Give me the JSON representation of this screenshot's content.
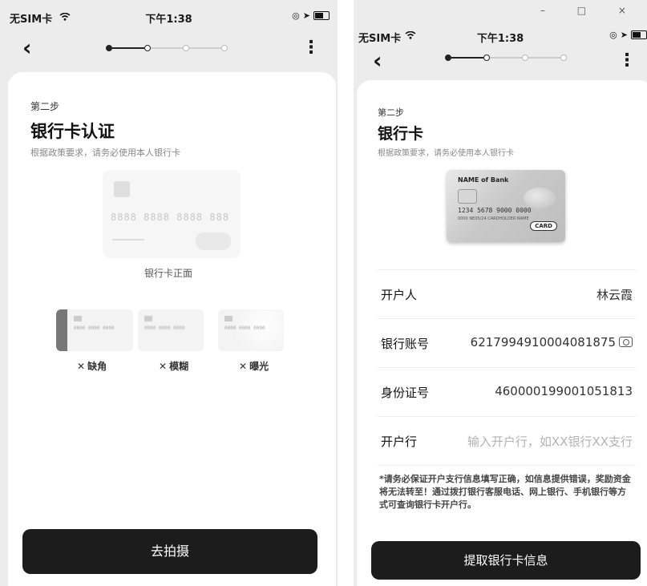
{
  "left": {
    "status": {
      "carrier": "无SIM卡",
      "time": "下午1:38"
    },
    "step_label": "第二步",
    "title": "银行卡认证",
    "subtitle": "根据政策要求，请务必使用本人银行卡",
    "card_number_sample": "8888 8888 8888 888",
    "card_caption": "银行卡正面",
    "examples": [
      {
        "label": "缺角",
        "mini": "0000 0000 0000"
      },
      {
        "label": "模糊",
        "mini": "0000 0000 0000"
      },
      {
        "label": "曝光",
        "mini": "0000 0000 0000"
      }
    ],
    "button_label": "去拍摄"
  },
  "right": {
    "window_controls": "– □ ×",
    "status": {
      "carrier": "无SIM卡",
      "time": "下午1:38"
    },
    "step_label": "第二步",
    "title": "银行卡",
    "subtitle": "根据政策要求，请务必使用本人银行卡",
    "card": {
      "bank_name": "NAME of Bank",
      "number": "1234 5678 9000 0000",
      "sub_text": "0000 NE05/24 CARDHOLDER NAME",
      "logo": "CARD"
    },
    "fields": [
      {
        "label": "开户人",
        "value": "林云霞",
        "placeholder": false
      },
      {
        "label": "银行账号",
        "value": "6217994910004081875",
        "placeholder": false,
        "icon": "camera-icon"
      },
      {
        "label": "身份证号",
        "value": "460000199001051813",
        "placeholder": false
      },
      {
        "label": "开户行",
        "value": "输入开户行，如XX银行XX支行",
        "placeholder": true
      }
    ],
    "notice": "*请务必保证开户支行信息填写正确，如信息提供错误，奖励资金将无法转至！通过拨打银行客服电话、网上银行、手机银行等方式可查询银行卡开户行。",
    "button_label": "提取银行卡信息"
  },
  "icons": {
    "wifi": "wifi-icon",
    "battery": "battery-icon",
    "back": "back-icon",
    "more": "more-vertical-icon",
    "camera": "camera-icon",
    "close": "x-icon"
  }
}
